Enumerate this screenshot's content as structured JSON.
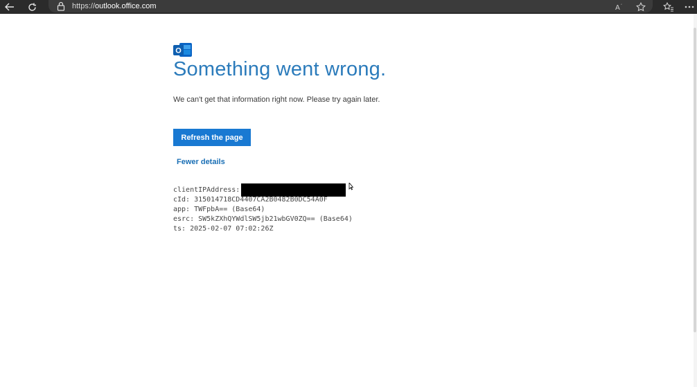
{
  "browser": {
    "url_prefix": "https://",
    "url_host": "outlook.office.com",
    "icons": [
      "back-arrow-icon",
      "refresh-icon",
      "lock-icon",
      "read-aloud-icon",
      "favorite-star-icon",
      "favorites-icon",
      "more-icon"
    ]
  },
  "error": {
    "logo_letter": "O",
    "title": "Something went wrong.",
    "message": "We can't get that information right now. Please try again later.",
    "refresh_button": "Refresh the page",
    "details_link": "Fewer details"
  },
  "diagnostics": {
    "client_ip_label": "clientIPAddress:",
    "cid": "cId: 315014718CD4407CA2B0482B0DC54A0F",
    "app": "app: TWFpbA== (Base64)",
    "esrc": "esrc: SW5kZXhQYWdlSW5jb21wbGV0ZQ== (Base64)",
    "ts": "ts: 2025-02-07 07:02:26Z"
  },
  "colors": {
    "accent": "#1979d2",
    "title": "#2b7bbb",
    "link": "#1a6fb5",
    "browser_bar": "#2b2b2b"
  }
}
